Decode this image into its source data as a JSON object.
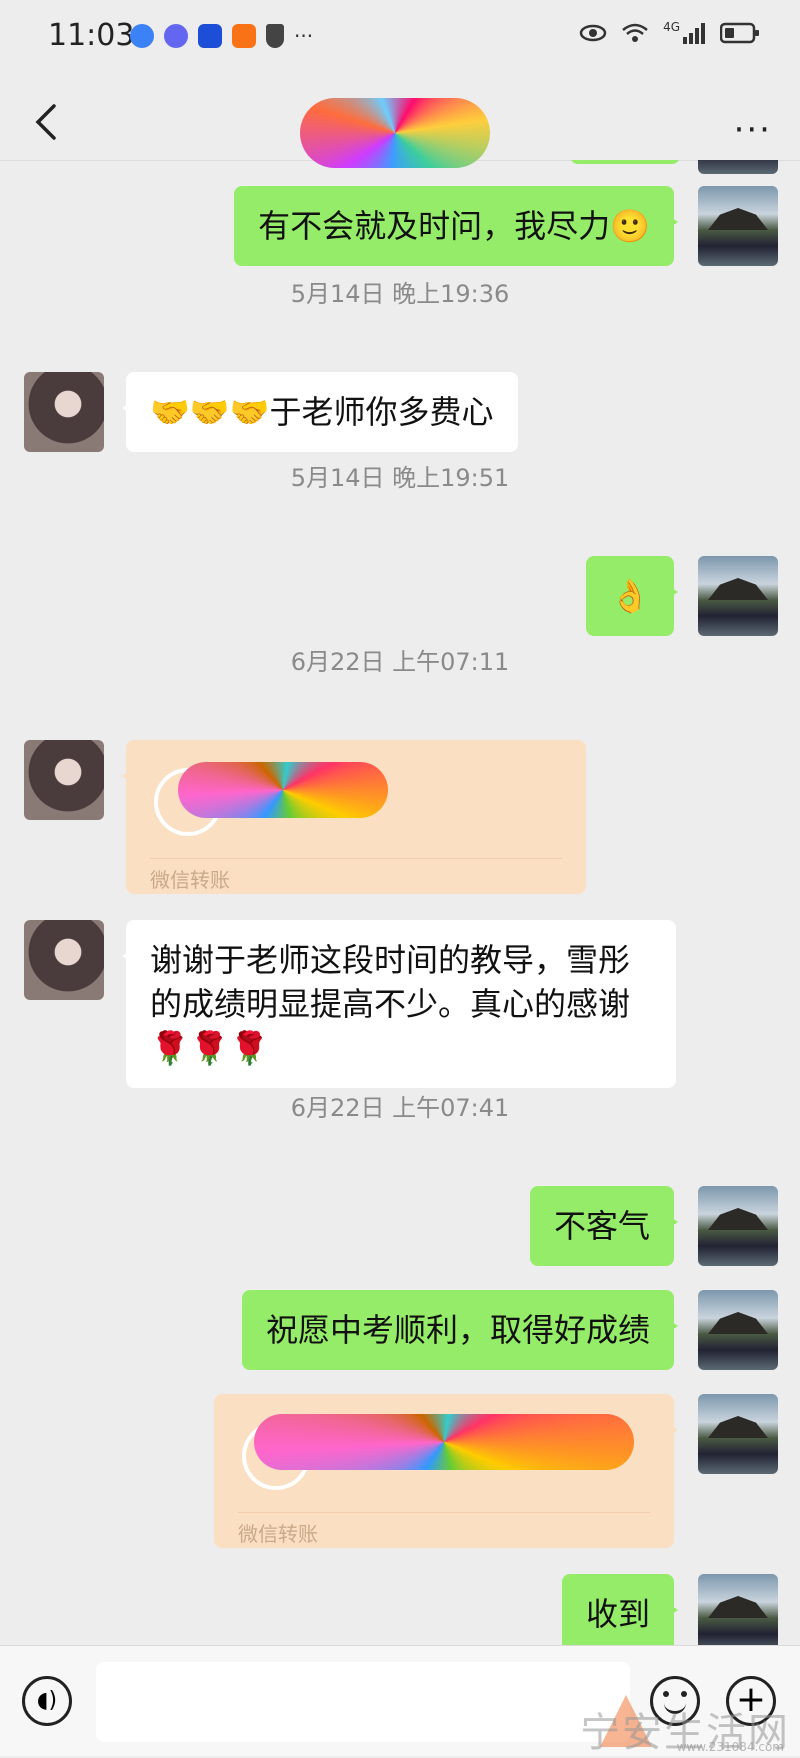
{
  "status": {
    "time": "11:03",
    "more": "···",
    "network": "4G"
  },
  "nav": {
    "more_label": "···"
  },
  "timestamps": [
    "5月14日 晚上19:36",
    "5月14日 晚上19:51",
    "6月22日 上午07:11",
    "6月22日 上午07:41"
  ],
  "messages": {
    "m1": "有不会就及时问，我尽力🙂",
    "m2": "🤝🤝🤝于老师你多费心",
    "m3": "👌",
    "m5": "谢谢于老师这段时间的教导，雪彤的成绩明显提高不少。真心的感谢🌹🌹🌹",
    "m6": "不客气",
    "m7": "祝愿中考顺利，取得好成绩",
    "m9": "收到"
  },
  "transfers": {
    "label": "微信转账"
  },
  "input": {
    "placeholder": ""
  },
  "watermark": {
    "text": "宁安生活网",
    "url": "www.231084.com"
  },
  "colors": {
    "my_bubble": "#95ec69",
    "other_bubble": "#ffffff",
    "transfer": "#fbdfc2",
    "background": "#ededed"
  }
}
